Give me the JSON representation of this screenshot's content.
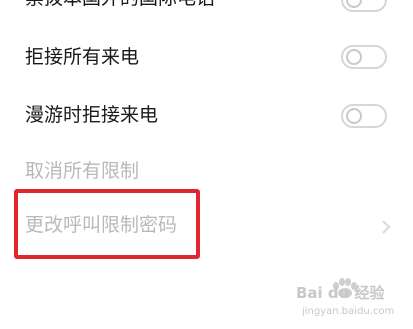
{
  "settings": {
    "items": [
      {
        "label": "禁拨本国外的国际电话",
        "type": "toggle",
        "on": false,
        "state": "partially-visible"
      },
      {
        "label": "拒接所有来电",
        "type": "toggle",
        "on": false
      },
      {
        "label": "漫游时拒接来电",
        "type": "toggle",
        "on": false
      },
      {
        "label": "取消所有限制",
        "type": "action",
        "enabled": false
      },
      {
        "label": "更改呼叫限制密码",
        "type": "link",
        "enabled": false
      }
    ]
  },
  "watermark": {
    "brand": "Bai du 经验",
    "url": "jingyan.baidu.com"
  },
  "colors": {
    "highlight": "#e0262f",
    "text_active": "#1a1a1a",
    "text_disabled": "#b9b9b9",
    "toggle_off": "#d6d6d6"
  }
}
